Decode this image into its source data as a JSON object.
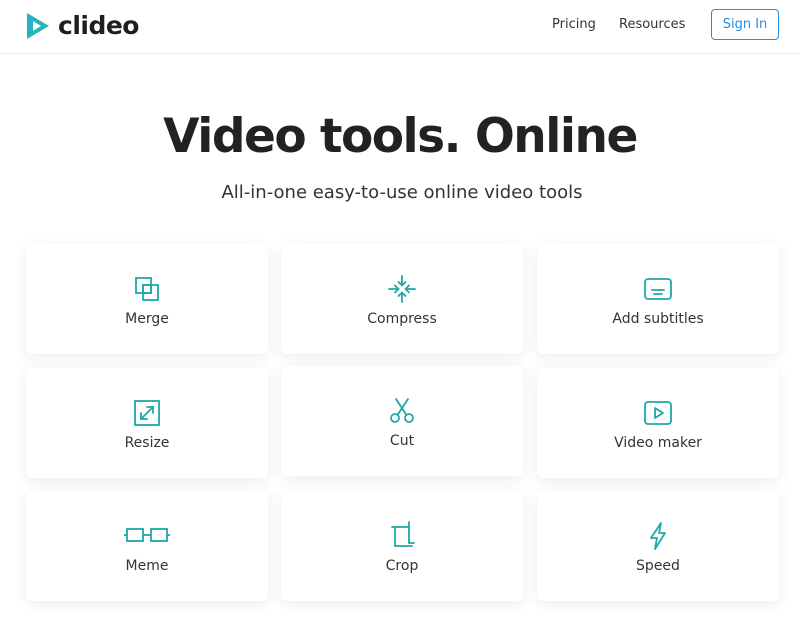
{
  "header": {
    "logo_text": "clideo",
    "nav": [
      {
        "label": "Pricing"
      },
      {
        "label": "Resources"
      }
    ],
    "signin_label": "Sign In"
  },
  "hero": {
    "title": "Video tools. Online",
    "subtitle": "All-in-one easy-to-use online video tools"
  },
  "tools": [
    {
      "label": "Merge",
      "icon": "merge-icon"
    },
    {
      "label": "Compress",
      "icon": "compress-icon"
    },
    {
      "label": "Add subtitles",
      "icon": "subtitles-icon"
    },
    {
      "label": "Resize",
      "icon": "resize-icon"
    },
    {
      "label": "Cut",
      "icon": "scissors-icon"
    },
    {
      "label": "Video maker",
      "icon": "play-icon"
    },
    {
      "label": "Meme",
      "icon": "meme-glasses-icon"
    },
    {
      "label": "Crop",
      "icon": "crop-icon"
    },
    {
      "label": "Speed",
      "icon": "lightning-icon"
    }
  ],
  "colors": {
    "accent": "#20a8a5",
    "signin": "#1f8ee6",
    "logo_gradient_start": "#25b5d6",
    "logo_gradient_end": "#1dc28f"
  }
}
